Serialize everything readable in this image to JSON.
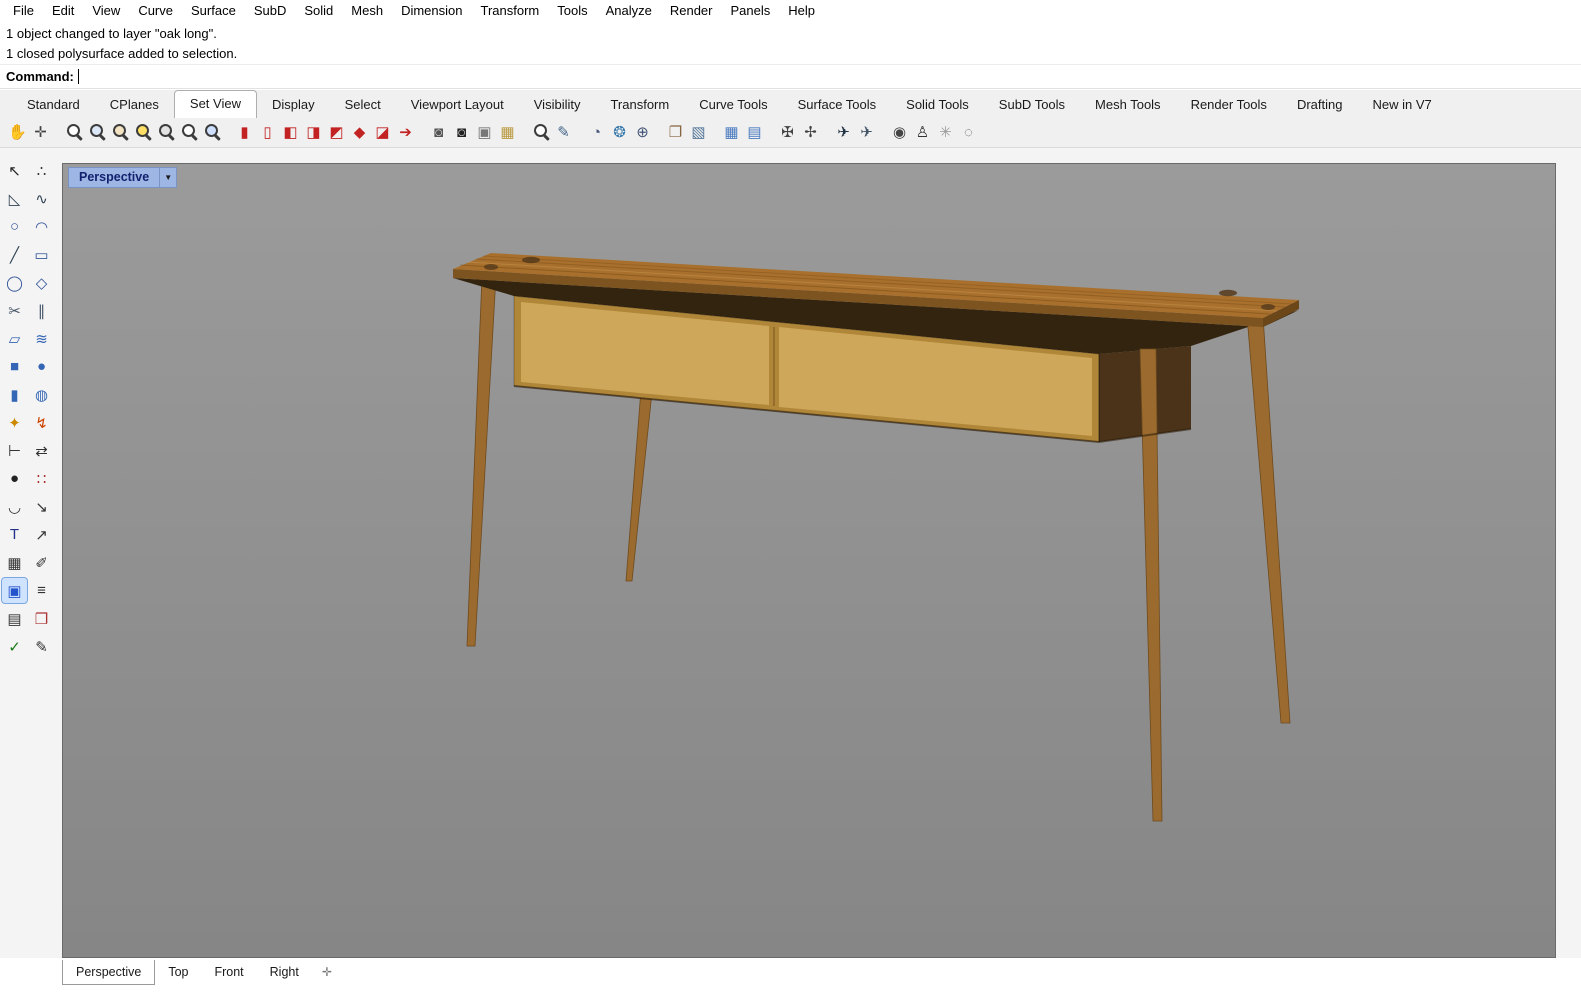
{
  "menu": {
    "items": [
      "File",
      "Edit",
      "View",
      "Curve",
      "Surface",
      "SubD",
      "Solid",
      "Mesh",
      "Dimension",
      "Transform",
      "Tools",
      "Analyze",
      "Render",
      "Panels",
      "Help"
    ]
  },
  "command": {
    "history": [
      "1 object changed to layer \"oak long\".",
      "1 closed polysurface added to selection."
    ],
    "prompt": "Command:"
  },
  "ribbon_tabs": {
    "items": [
      {
        "label": "Standard"
      },
      {
        "label": "CPlanes"
      },
      {
        "label": "Set View",
        "active": true
      },
      {
        "label": "Display"
      },
      {
        "label": "Select"
      },
      {
        "label": "Viewport Layout"
      },
      {
        "label": "Visibility"
      },
      {
        "label": "Transform"
      },
      {
        "label": "Curve Tools"
      },
      {
        "label": "Surface Tools"
      },
      {
        "label": "Solid Tools"
      },
      {
        "label": "SubD Tools"
      },
      {
        "label": "Mesh Tools"
      },
      {
        "label": "Render Tools"
      },
      {
        "label": "Drafting"
      },
      {
        "label": "New in V7"
      }
    ]
  },
  "toolbar": {
    "icons": [
      {
        "name": "pan-hand-icon",
        "kind": "glyph",
        "glyph": "✋",
        "color": "#b5895b"
      },
      {
        "name": "pan-view-icon",
        "kind": "glyph",
        "glyph": "✛",
        "color": "#444444"
      },
      {
        "name": "zoom-dynamic-icon",
        "kind": "mag",
        "lens": "#ffffff",
        "sep": true
      },
      {
        "name": "zoom-window-icon",
        "kind": "mag",
        "lens": "#dce8f8"
      },
      {
        "name": "zoom-selected-icon",
        "kind": "mag",
        "lens": "#f3e3c3"
      },
      {
        "name": "zoom-extents-icon",
        "kind": "mag",
        "lens": "#ffe066"
      },
      {
        "name": "zoom-back-icon",
        "kind": "mag",
        "lens": "#e3e3e3"
      },
      {
        "name": "zoom-out-icon",
        "kind": "mag",
        "lens": "#ffffff"
      },
      {
        "name": "zoom-1to1-icon",
        "kind": "mag",
        "lens": "#cfe0ff"
      },
      {
        "name": "view-back-icon",
        "kind": "glyph",
        "glyph": "▮",
        "color": "#c32222",
        "sep": true
      },
      {
        "name": "view-forward-icon",
        "kind": "glyph",
        "glyph": "▯",
        "color": "#c32222"
      },
      {
        "name": "front-view-icon",
        "kind": "glyph",
        "glyph": "◧",
        "color": "#c32222"
      },
      {
        "name": "right-view-icon",
        "kind": "glyph",
        "glyph": "◨",
        "color": "#c32222"
      },
      {
        "name": "top-view-icon",
        "kind": "glyph",
        "glyph": "◩",
        "color": "#c32222"
      },
      {
        "name": "perspective-view-icon",
        "kind": "glyph",
        "glyph": "◆",
        "color": "#c32222"
      },
      {
        "name": "isometric-view-icon",
        "kind": "glyph",
        "glyph": "◪",
        "color": "#c32222"
      },
      {
        "name": "rotate-view-icon",
        "kind": "glyph",
        "glyph": "➔",
        "color": "#c32222"
      },
      {
        "name": "camera-icon",
        "kind": "glyph",
        "glyph": "◙",
        "color": "#555555",
        "sep": true
      },
      {
        "name": "camera-settings-icon",
        "kind": "glyph",
        "glyph": "◙",
        "color": "#222222"
      },
      {
        "name": "projector-icon",
        "kind": "glyph",
        "glyph": "▣",
        "color": "#777777"
      },
      {
        "name": "save-view-icon",
        "kind": "glyph",
        "glyph": "▦",
        "color": "#b9983f"
      },
      {
        "name": "magnify-small-icon",
        "kind": "mag",
        "lens": "#ffffff",
        "sep": true
      },
      {
        "name": "zoom-2d-icon",
        "kind": "glyph",
        "glyph": "✎",
        "color": "#446688"
      },
      {
        "name": "rotate-circle-icon",
        "kind": "glyph",
        "glyph": "◔",
        "color": "#445577",
        "sep": true
      },
      {
        "name": "orbit-sphere-icon",
        "kind": "glyph",
        "glyph": "❂",
        "color": "#3377aa"
      },
      {
        "name": "set-camera-icon",
        "kind": "glyph",
        "glyph": "⊕",
        "color": "#445577"
      },
      {
        "name": "view-cube-icon",
        "kind": "glyph",
        "glyph": "❐",
        "color": "#886644",
        "sep": true
      },
      {
        "name": "axes-cube-icon",
        "kind": "glyph",
        "glyph": "▧",
        "color": "#557799"
      },
      {
        "name": "cplane-icon",
        "kind": "glyph",
        "glyph": "▦",
        "color": "#4a7abf",
        "sep": true
      },
      {
        "name": "cplane-move-icon",
        "kind": "glyph",
        "glyph": "▤",
        "color": "#4a7abf"
      },
      {
        "name": "align-vertical-icon",
        "kind": "glyph",
        "glyph": "✠",
        "color": "#444444",
        "sep": true
      },
      {
        "name": "spin-view-icon",
        "kind": "glyph",
        "glyph": "✢",
        "color": "#444444"
      },
      {
        "name": "fly-mode-icon",
        "kind": "glyph",
        "glyph": "✈",
        "color": "#223344",
        "sep": true
      },
      {
        "name": "fly-back-icon",
        "kind": "glyph",
        "glyph": "✈",
        "color": "#445566"
      },
      {
        "name": "comment-view-icon",
        "kind": "glyph",
        "glyph": "◉",
        "color": "#444444",
        "sep": true
      },
      {
        "name": "walk-mode-icon",
        "kind": "glyph",
        "glyph": "♙",
        "color": "#333333"
      },
      {
        "name": "sun-icon",
        "kind": "glyph",
        "glyph": "✳",
        "color": "#999999"
      },
      {
        "name": "dashed-circle-icon",
        "kind": "glyph",
        "glyph": "◌",
        "color": "#555555"
      }
    ]
  },
  "sidebar": {
    "icons": [
      {
        "name": "select-icon",
        "glyph": "↖",
        "color": "#222222"
      },
      {
        "name": "point-icon",
        "glyph": "∴",
        "color": "#333333"
      },
      {
        "name": "polyline-icon",
        "glyph": "◺",
        "color": "#334455"
      },
      {
        "name": "curve-icon",
        "glyph": "∿",
        "color": "#334455"
      },
      {
        "name": "circle-icon",
        "glyph": "○",
        "color": "#335599"
      },
      {
        "name": "arc-icon",
        "glyph": "◠",
        "color": "#335599"
      },
      {
        "name": "line-icon",
        "glyph": "╱",
        "color": "#334455"
      },
      {
        "name": "rectangle-icon",
        "glyph": "▭",
        "color": "#335599"
      },
      {
        "name": "ellipse-icon",
        "glyph": "◯",
        "color": "#335599"
      },
      {
        "name": "polygon-icon",
        "glyph": "◇",
        "color": "#335599"
      },
      {
        "name": "curve-tools-icon",
        "glyph": "✂",
        "color": "#445566"
      },
      {
        "name": "offset-icon",
        "glyph": "∥",
        "color": "#445566"
      },
      {
        "name": "surface-icon",
        "glyph": "▱",
        "color": "#3566b5"
      },
      {
        "name": "loft-icon",
        "glyph": "≋",
        "color": "#3566b5"
      },
      {
        "name": "box-icon",
        "glyph": "■",
        "color": "#3566b5"
      },
      {
        "name": "sphere-icon",
        "glyph": "●",
        "color": "#3566b5"
      },
      {
        "name": "cylinder-icon",
        "glyph": "▮",
        "color": "#3566b5"
      },
      {
        "name": "tube-icon",
        "glyph": "◍",
        "color": "#3566b5"
      },
      {
        "name": "boolean-icon",
        "glyph": "✦",
        "color": "#cc8800"
      },
      {
        "name": "bend-icon",
        "glyph": "↯",
        "color": "#cc4400"
      },
      {
        "name": "trim-icon",
        "glyph": "⊢",
        "color": "#333333"
      },
      {
        "name": "split-icon",
        "glyph": "⇄",
        "color": "#333333"
      },
      {
        "name": "render-icon",
        "glyph": "●",
        "color": "#222222"
      },
      {
        "name": "points-on-icon",
        "glyph": "∷",
        "color": "#aa3333"
      },
      {
        "name": "blend-icon",
        "glyph": "◡",
        "color": "#333333"
      },
      {
        "name": "scale-icon",
        "glyph": "↘",
        "color": "#333333"
      },
      {
        "name": "text-icon",
        "glyph": "T",
        "color": "#223388"
      },
      {
        "name": "leader-icon",
        "glyph": "↗",
        "color": "#333333"
      },
      {
        "name": "hatch-icon",
        "glyph": "▦",
        "color": "#333333"
      },
      {
        "name": "flow-icon",
        "glyph": "✐",
        "color": "#333333"
      },
      {
        "name": "gumball-icon",
        "glyph": "▣",
        "color": "#2255cc",
        "selected": true
      },
      {
        "name": "list-icon",
        "glyph": "≡",
        "color": "#333333"
      },
      {
        "name": "grid-snap-icon",
        "glyph": "▤",
        "color": "#333333"
      },
      {
        "name": "block-icon",
        "glyph": "❒",
        "color": "#aa3333"
      },
      {
        "name": "check-icon",
        "glyph": "✓",
        "color": "#1a7a1a"
      },
      {
        "name": "annotate-icon",
        "glyph": "✎",
        "color": "#333333"
      }
    ]
  },
  "viewport": {
    "label": "Perspective",
    "dropdown_icon": "▼",
    "background_top": "#9b9b9b",
    "background_bottom": "#868686",
    "model": {
      "description": "mid-century wooden desk with two drawers and four splayed tapered legs",
      "colors": {
        "top": "#a8702c",
        "top_edge": "#7d5420",
        "top_edge_end": "#6b4619",
        "drawer_frame": "#b08638",
        "drawer": "#cfa75a",
        "side_dark": "#4a3318",
        "underside": "#33240f",
        "legs": "#9a6a2e",
        "joint": "#55391b"
      }
    }
  },
  "viewport_tabs": {
    "items": [
      {
        "label": "Perspective",
        "active": true
      },
      {
        "label": "Top"
      },
      {
        "label": "Front"
      },
      {
        "label": "Right"
      }
    ],
    "add_icon": "✛"
  }
}
